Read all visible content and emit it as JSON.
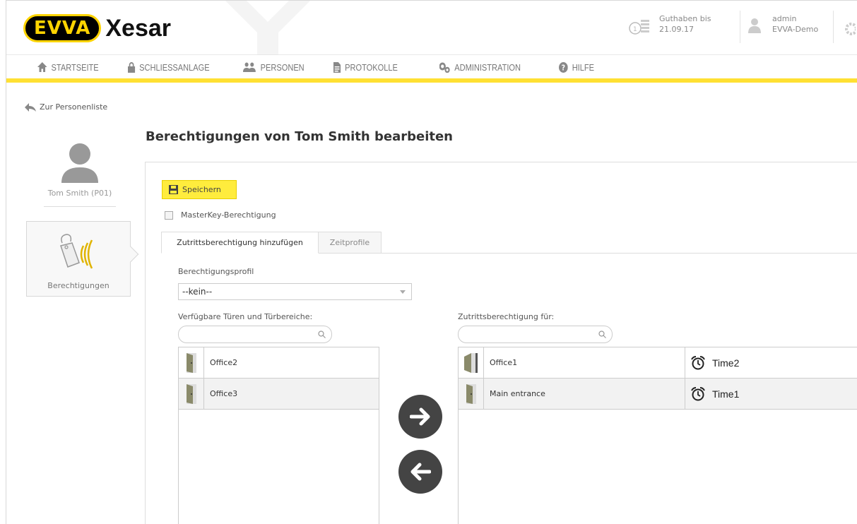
{
  "header": {
    "logo_badge": "EVVA",
    "logo_product": "Xesar",
    "credit_label": "Guthaben bis",
    "credit_date": "21.09.17",
    "user_name": "admin",
    "user_org": "EVVA-Demo"
  },
  "nav": {
    "items": [
      {
        "label": "Startseite",
        "icon": "home-icon"
      },
      {
        "label": "Schliessanlage",
        "icon": "lock-icon"
      },
      {
        "label": "Personen",
        "icon": "people-icon"
      },
      {
        "label": "Protokolle",
        "icon": "document-icon"
      },
      {
        "label": "Administration",
        "icon": "gears-icon"
      },
      {
        "label": "Hilfe",
        "icon": "help-icon"
      }
    ],
    "accent": "#ffe033"
  },
  "sidebar": {
    "back_link": "Zur Personenliste",
    "person_name": "Tom Smith (P01)",
    "permissions_label": "Berechtigungen"
  },
  "main": {
    "title": "Berechtigungen von Tom Smith bearbeiten",
    "save_label": "Speichern",
    "masterkey_label": "MasterKey-Berechtigung",
    "tabs": [
      {
        "label": "Zutrittsberechtigung hinzufügen",
        "active": true
      },
      {
        "label": "Zeitprofile",
        "active": false
      }
    ],
    "profile_label": "Berechtigungsprofil",
    "profile_value": "--kein--",
    "available_label": "Verfügbare Türen und Türbereiche:",
    "assigned_label": "Zutrittsberechtigung für:",
    "available_doors": [
      {
        "name": "Office2",
        "selected": false
      },
      {
        "name": "Office3",
        "selected": true
      }
    ],
    "assigned_doors": [
      {
        "name": "Office1",
        "time_profile": "Time2",
        "selected": false
      },
      {
        "name": "Main entrance",
        "time_profile": "Time1",
        "selected": true
      }
    ]
  }
}
